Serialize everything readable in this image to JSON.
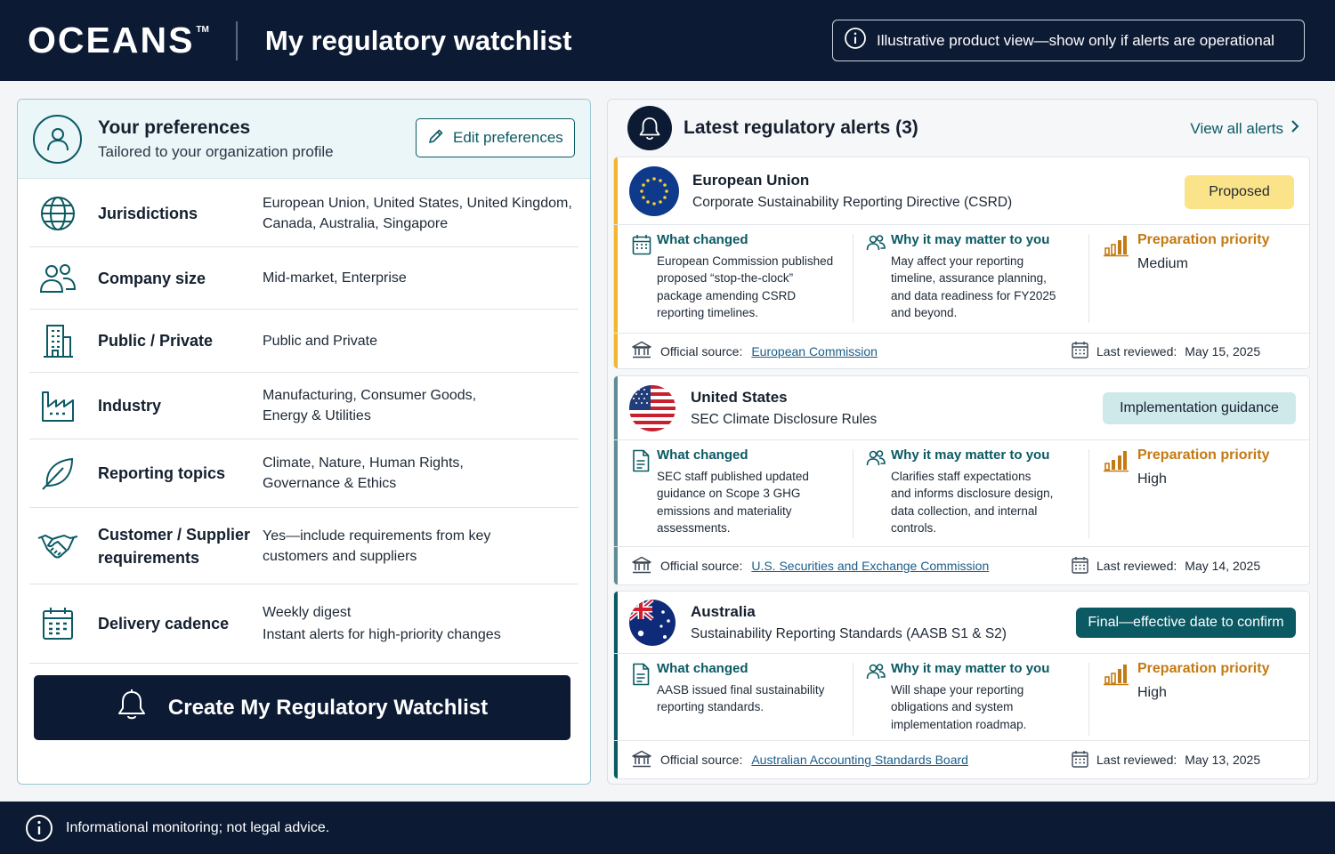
{
  "header": {
    "logo": "OCEANS",
    "trademark": "TM",
    "title": "My regulatory watchlist",
    "notice": "Illustrative product view—show only if alerts are operational"
  },
  "preferences": {
    "title": "Your preferences",
    "subtitle": "Tailored to your organization profile",
    "edit_label": "Edit preferences",
    "rows": [
      {
        "label": "Jurisdictions",
        "value": "European Union, United States, United Kingdom,\nCanada, Australia, Singapore",
        "icon": "globe-icon"
      },
      {
        "label": "Company size",
        "value": "Mid-market, Enterprise",
        "icon": "users-icon"
      },
      {
        "label": "Public / Private",
        "value": "Public and Private",
        "icon": "building-icon"
      },
      {
        "label": "Industry",
        "value": "Manufacturing, Consumer Goods,\nEnergy & Utilities",
        "icon": "factory-icon"
      },
      {
        "label": "Reporting topics",
        "value": "Climate, Nature, Human Rights,\nGovernance & Ethics",
        "icon": "leaf-icon"
      },
      {
        "label": "Customer / Supplier\nrequirements",
        "value": "Yes—include requirements from key\ncustomers and suppliers",
        "icon": "handshake-icon"
      },
      {
        "label": "Delivery cadence",
        "value": "Weekly digest\nInstant alerts for high-priority changes",
        "icon": "calendar-icon"
      }
    ],
    "create_label": "Create My Regulatory Watchlist"
  },
  "alerts": {
    "title": "Latest regulatory alerts (3)",
    "view_all": "View all alerts",
    "labels": {
      "what": "What changed",
      "why": "Why it may matter to you",
      "priority": "Preparation priority",
      "source": "Official source:",
      "reviewed_prefix": "Last reviewed:"
    },
    "items": [
      {
        "region": "European Union",
        "regulation": "Corporate Sustainability Reporting Directive (CSRD)",
        "status": "Proposed",
        "what": "European Commission published\nproposed “stop-the-clock”\npackage amending CSRD\nreporting timelines.",
        "why": "May affect your reporting\ntimeline, assurance planning,\nand data readiness for FY2025\nand beyond.",
        "priority": "Medium",
        "source": "European Commission",
        "reviewed": "May 15, 2025",
        "accent": "#f2b72e",
        "badge_bg": "#fbe38a",
        "badge_fg": "#1d2835"
      },
      {
        "region": "United States",
        "regulation": "SEC Climate Disclosure Rules",
        "status": "Implementation guidance",
        "what": "SEC staff published updated\nguidance on Scope 3 GHG\nemissions and materiality\nassessments.",
        "why": "Clarifies staff expectations\nand informs disclosure design,\ndata collection, and internal\ncontrols.",
        "priority": "High",
        "source": "U.S. Securities and Exchange Commission",
        "reviewed": "May 14, 2025",
        "accent": "#5f8c96",
        "badge_bg": "#cfe8ea",
        "badge_fg": "#14202e"
      },
      {
        "region": "Australia",
        "regulation": "Sustainability Reporting Standards (AASB S1 & S2)",
        "status": "Final—effective date to confirm",
        "what": "AASB issued final sustainability\nreporting standards.",
        "why": "Will shape your reporting\nobligations and system\nimplementation roadmap.",
        "priority": "High",
        "source": "Australian Accounting Standards Board",
        "reviewed": "May 13, 2025",
        "accent": "#0b5a63",
        "badge_bg": "#0b5a63",
        "badge_fg": "#ffffff"
      }
    ]
  },
  "footer": {
    "text": "Informational monitoring; not legal advice."
  }
}
